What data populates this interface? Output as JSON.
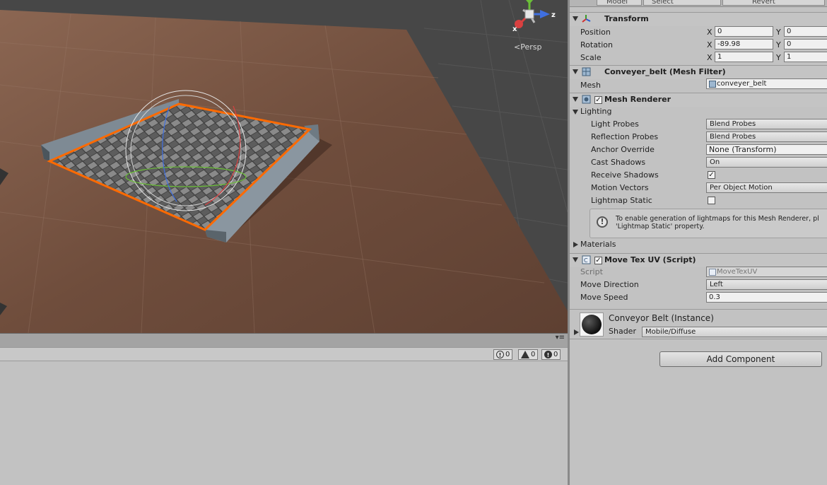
{
  "scene": {
    "view_mode": "Persp",
    "gizmo_axes": [
      "x",
      "y",
      "z"
    ],
    "colors": {
      "ground": "#6e4a38",
      "sky": "#474747",
      "selection": "#ff6a00"
    }
  },
  "console": {
    "error_count": "0",
    "warning_count": "0",
    "message_count": "0",
    "menu_glyph": "▾≡"
  },
  "inspector": {
    "top_tabs": [
      "Model",
      "Select",
      "Revert"
    ],
    "transform": {
      "title": "Transform",
      "position_label": "Position",
      "position": {
        "x": "0",
        "y": "0"
      },
      "rotation_label": "Rotation",
      "rotation": {
        "x": "-89.98",
        "y": "0"
      },
      "scale_label": "Scale",
      "scale": {
        "x": "1",
        "y": "1"
      }
    },
    "mesh_filter": {
      "title": "Conveyer_belt (Mesh Filter)",
      "mesh_label": "Mesh",
      "mesh_value": "conveyer_belt"
    },
    "mesh_renderer": {
      "title": "Mesh Renderer",
      "lighting_label": "Lighting",
      "light_probes_label": "Light Probes",
      "light_probes": "Blend Probes",
      "reflection_probes_label": "Reflection Probes",
      "reflection_probes": "Blend Probes",
      "anchor_override_label": "Anchor Override",
      "anchor_override": "None (Transform)",
      "cast_shadows_label": "Cast Shadows",
      "cast_shadows": "On",
      "receive_shadows_label": "Receive Shadows",
      "receive_shadows_checked": true,
      "motion_vectors_label": "Motion Vectors",
      "motion_vectors": "Per Object Motion",
      "lightmap_static_label": "Lightmap Static",
      "lightmap_static_checked": false,
      "help_text": "To enable generation of lightmaps for this Mesh Renderer, pl\n'Lightmap Static' property.",
      "materials_label": "Materials"
    },
    "move_tex_uv": {
      "title": "Move Tex UV (Script)",
      "script_label": "Script",
      "script_value": "MoveTexUV",
      "move_direction_label": "Move Direction",
      "move_direction": "Left",
      "move_speed_label": "Move Speed",
      "move_speed": "0.3"
    },
    "material": {
      "name": "Conveyor Belt (Instance)",
      "shader_label": "Shader",
      "shader_value": "Mobile/Diffuse"
    },
    "add_component_label": "Add Component"
  }
}
